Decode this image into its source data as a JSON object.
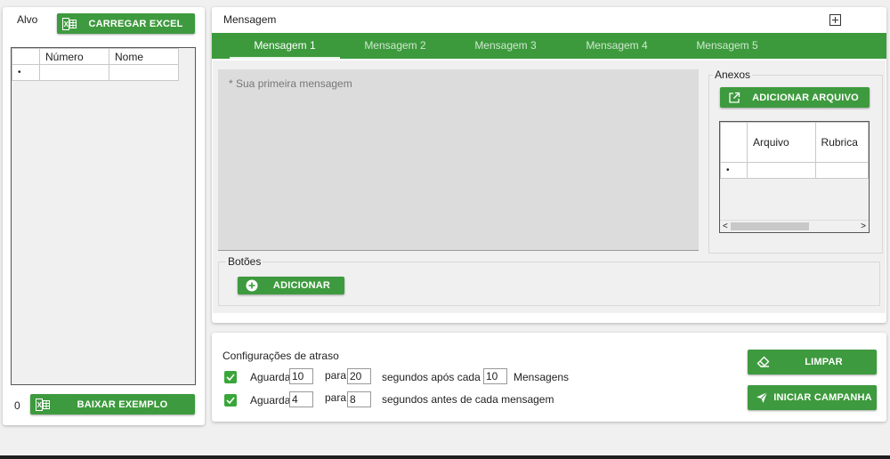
{
  "target": {
    "title": "Alvo",
    "load_button": "CARREGAR EXCEL",
    "table_headers": [
      "Número",
      "Nome"
    ],
    "new_row_marker": "•",
    "count": "0",
    "download_button": "BAIXAR EXEMPLO"
  },
  "message": {
    "title": "Mensagem",
    "tabs": [
      "Mensagem 1",
      "Mensagem 2",
      "Mensagem 3",
      "Mensagem 4",
      "Mensagem 5"
    ],
    "active_tab": 0,
    "placeholder": "* Sua primeira mensagem",
    "attachments": {
      "legend": "Anexos",
      "add_button": "ADICIONAR ARQUIVO",
      "headers": [
        "Arquivo",
        "Rubrica"
      ],
      "new_row_marker": "•"
    },
    "buttons": {
      "legend": "Botões",
      "add_button": "ADICIONAR"
    }
  },
  "delay": {
    "title": "Configurações de atraso",
    "row1": {
      "checked": true,
      "wait_label": "Aguarda",
      "from": "10",
      "to_label": "para",
      "to": "20",
      "after_label": "segundos após cada",
      "count": "10",
      "messages_label": "Mensagens"
    },
    "row2": {
      "checked": true,
      "wait_label": "Aguarda",
      "from": "4",
      "to_label": "para",
      "to": "8",
      "after_label": "segundos antes de cada mensagem"
    },
    "clear_button": "LIMPAR",
    "start_button": "INICIAR CAMPANHA"
  },
  "colors": {
    "accent": "#3e9a3e",
    "tabbar": "#3c9a3c"
  },
  "icons": [
    "excel-icon",
    "plus-square-icon",
    "external-link-icon",
    "plus-circle-icon",
    "eraser-icon",
    "send-icon",
    "check-icon"
  ]
}
